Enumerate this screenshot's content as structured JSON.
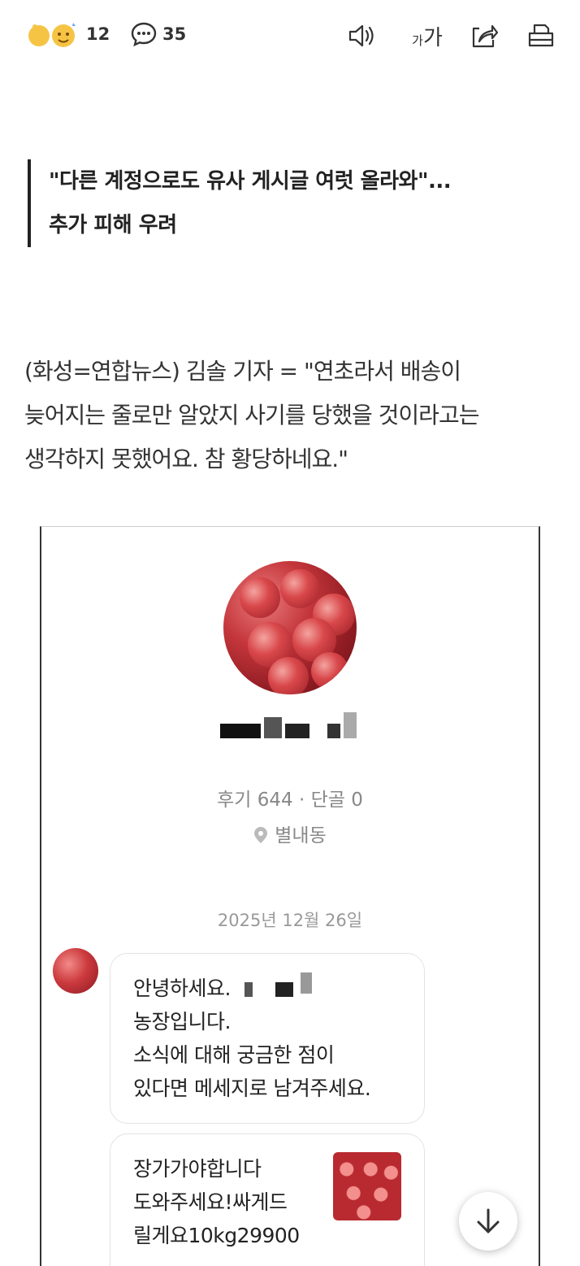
{
  "toolbar": {
    "likes_count": "12",
    "comments_count": "35",
    "font_size_label_small": "가",
    "font_size_label_large": "가",
    "icons": [
      "thumbs-up-emoji-icon",
      "comment-icon",
      "speaker-icon",
      "font-size-icon",
      "share-icon",
      "print-icon"
    ]
  },
  "article": {
    "subheading_line1": "\"다른 계정으로도 유사 게시글 여럿 올라와\"...",
    "subheading_line2": "추가 피해 우려",
    "lead_line1": "(화성=연합뉴스) 김솔 기자 = \"연초라서 배송이",
    "lead_line2": "늦어지는 줄로만 알았지 사기를 당했을 것이라고는",
    "lead_line3": "생각하지 못했어요. 참 황당하네요.\""
  },
  "screenshot": {
    "profile_stats": "후기 644 · 단골 0",
    "location": "별내동",
    "chat_date": "2025년 12월 26일",
    "message1_line1": "안녕하세요.",
    "message1_line2": "농장입니다.",
    "message1_line3": "소식에 대해 궁금한 점이",
    "message1_line4": "있다면 메세지로 남겨주세요.",
    "message2_line1": "장가가야합니다",
    "message2_line2": "도와주세요!싸게드",
    "message2_line3": "릴게요10kg29900"
  },
  "colors": {
    "accent_red": "#c4363b",
    "text_dark": "#222222",
    "text_muted": "#888888"
  }
}
